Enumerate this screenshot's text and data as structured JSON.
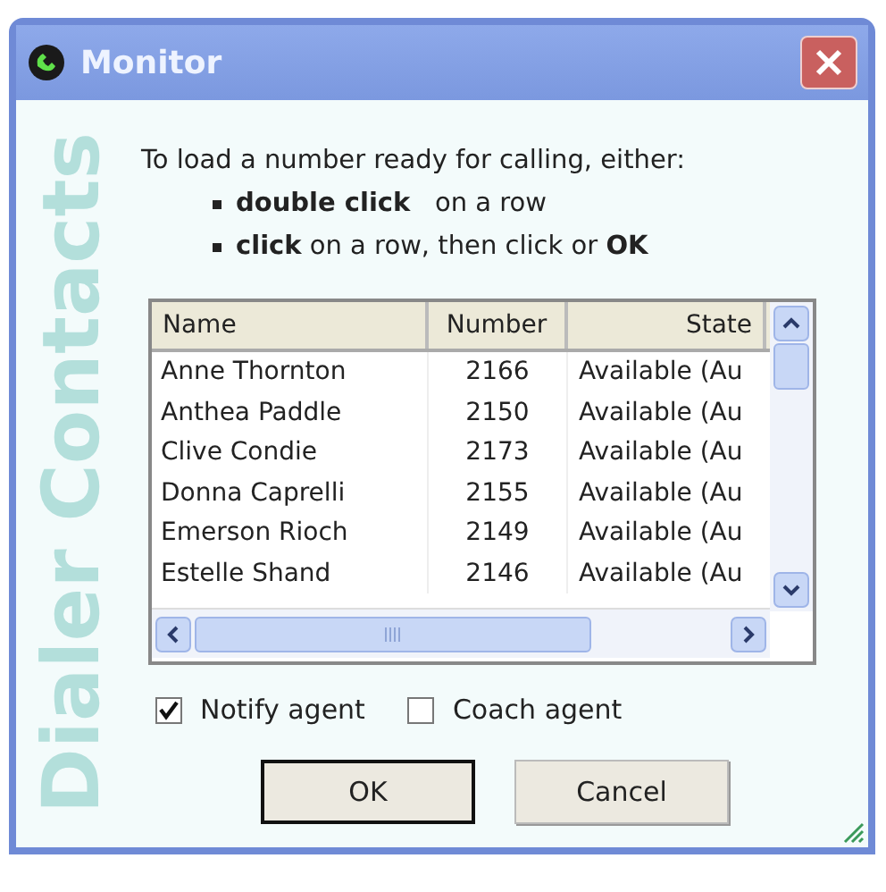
{
  "window": {
    "title": "Monitor"
  },
  "side_label": "Dialer Contacts",
  "instructions": {
    "intro": "To load a number ready for calling, either:",
    "bullets": [
      "**double click**   on a row",
      "**click** on a row, then click or **OK**"
    ]
  },
  "table": {
    "columns": [
      "Name",
      "Number",
      "State"
    ],
    "rows": [
      {
        "name": "Anne Thornton",
        "number": "2166",
        "state": "Available (Au"
      },
      {
        "name": "Anthea Paddle",
        "number": "2150",
        "state": "Available (Au"
      },
      {
        "name": "Clive Condie",
        "number": "2173",
        "state": "Available (Au"
      },
      {
        "name": "Donna Caprelli",
        "number": "2155",
        "state": "Available (Au"
      },
      {
        "name": "Emerson Rioch",
        "number": "2149",
        "state": "Available (Au"
      },
      {
        "name": "Estelle Shand",
        "number": "2146",
        "state": "Available (Au"
      }
    ]
  },
  "options": [
    {
      "label": "Notify agent",
      "checked": true
    },
    {
      "label": "Coach agent",
      "checked": false
    }
  ],
  "buttons": [
    {
      "label": "OK",
      "default": true
    },
    {
      "label": "Cancel",
      "default": false
    }
  ]
}
